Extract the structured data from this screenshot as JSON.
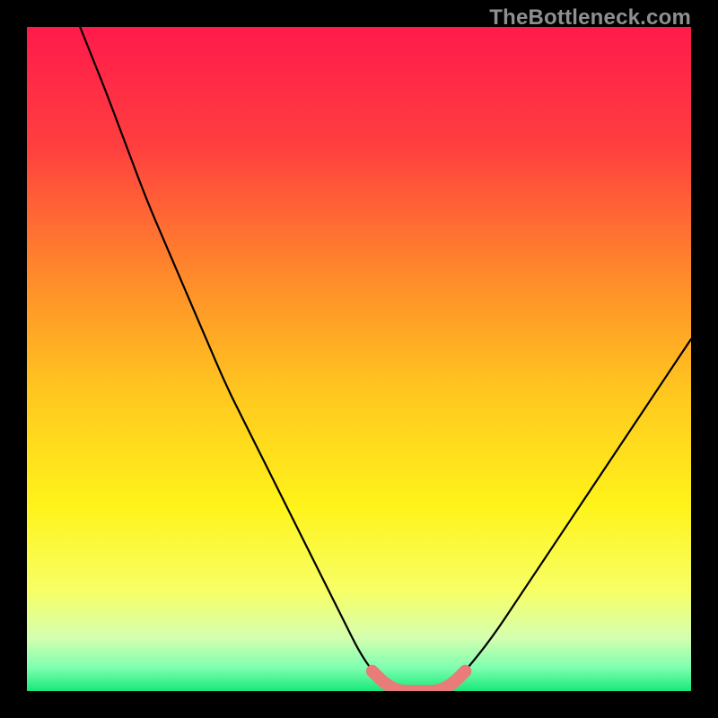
{
  "watermark": "TheBottleneck.com",
  "colors": {
    "frame": "#000000",
    "curve": "#000000",
    "highlight": "#e97c78",
    "gradient_stops": [
      {
        "offset": 0.0,
        "color": "#ff1a4b"
      },
      {
        "offset": 0.18,
        "color": "#ff3f3f"
      },
      {
        "offset": 0.38,
        "color": "#ff8c2a"
      },
      {
        "offset": 0.55,
        "color": "#ffc71f"
      },
      {
        "offset": 0.72,
        "color": "#fff31a"
      },
      {
        "offset": 0.85,
        "color": "#f7ff66"
      },
      {
        "offset": 0.92,
        "color": "#d4ffb0"
      },
      {
        "offset": 0.965,
        "color": "#7dffb0"
      },
      {
        "offset": 1.0,
        "color": "#18e87a"
      }
    ]
  },
  "chart_data": {
    "type": "line",
    "title": "",
    "xlabel": "",
    "ylabel": "",
    "xlim": [
      0,
      100
    ],
    "ylim": [
      0,
      100
    ],
    "x": [
      8,
      10,
      12,
      15,
      18,
      21,
      24,
      27,
      30,
      33,
      36,
      39,
      42,
      45,
      48,
      50,
      52,
      54,
      56,
      58,
      60,
      62,
      64,
      66,
      70,
      74,
      78,
      82,
      86,
      90,
      94,
      98,
      100
    ],
    "series": [
      {
        "name": "bottleneck-curve",
        "values": [
          100,
          95,
          90,
          82,
          74,
          67,
          60,
          53,
          46,
          40,
          34,
          28,
          22,
          16,
          10,
          6,
          3,
          1,
          0,
          0,
          0,
          0,
          1,
          3,
          8,
          14,
          20,
          26,
          32,
          38,
          44,
          50,
          53
        ]
      }
    ],
    "highlight_range_x": [
      52,
      66
    ],
    "grid": false,
    "legend": false
  }
}
